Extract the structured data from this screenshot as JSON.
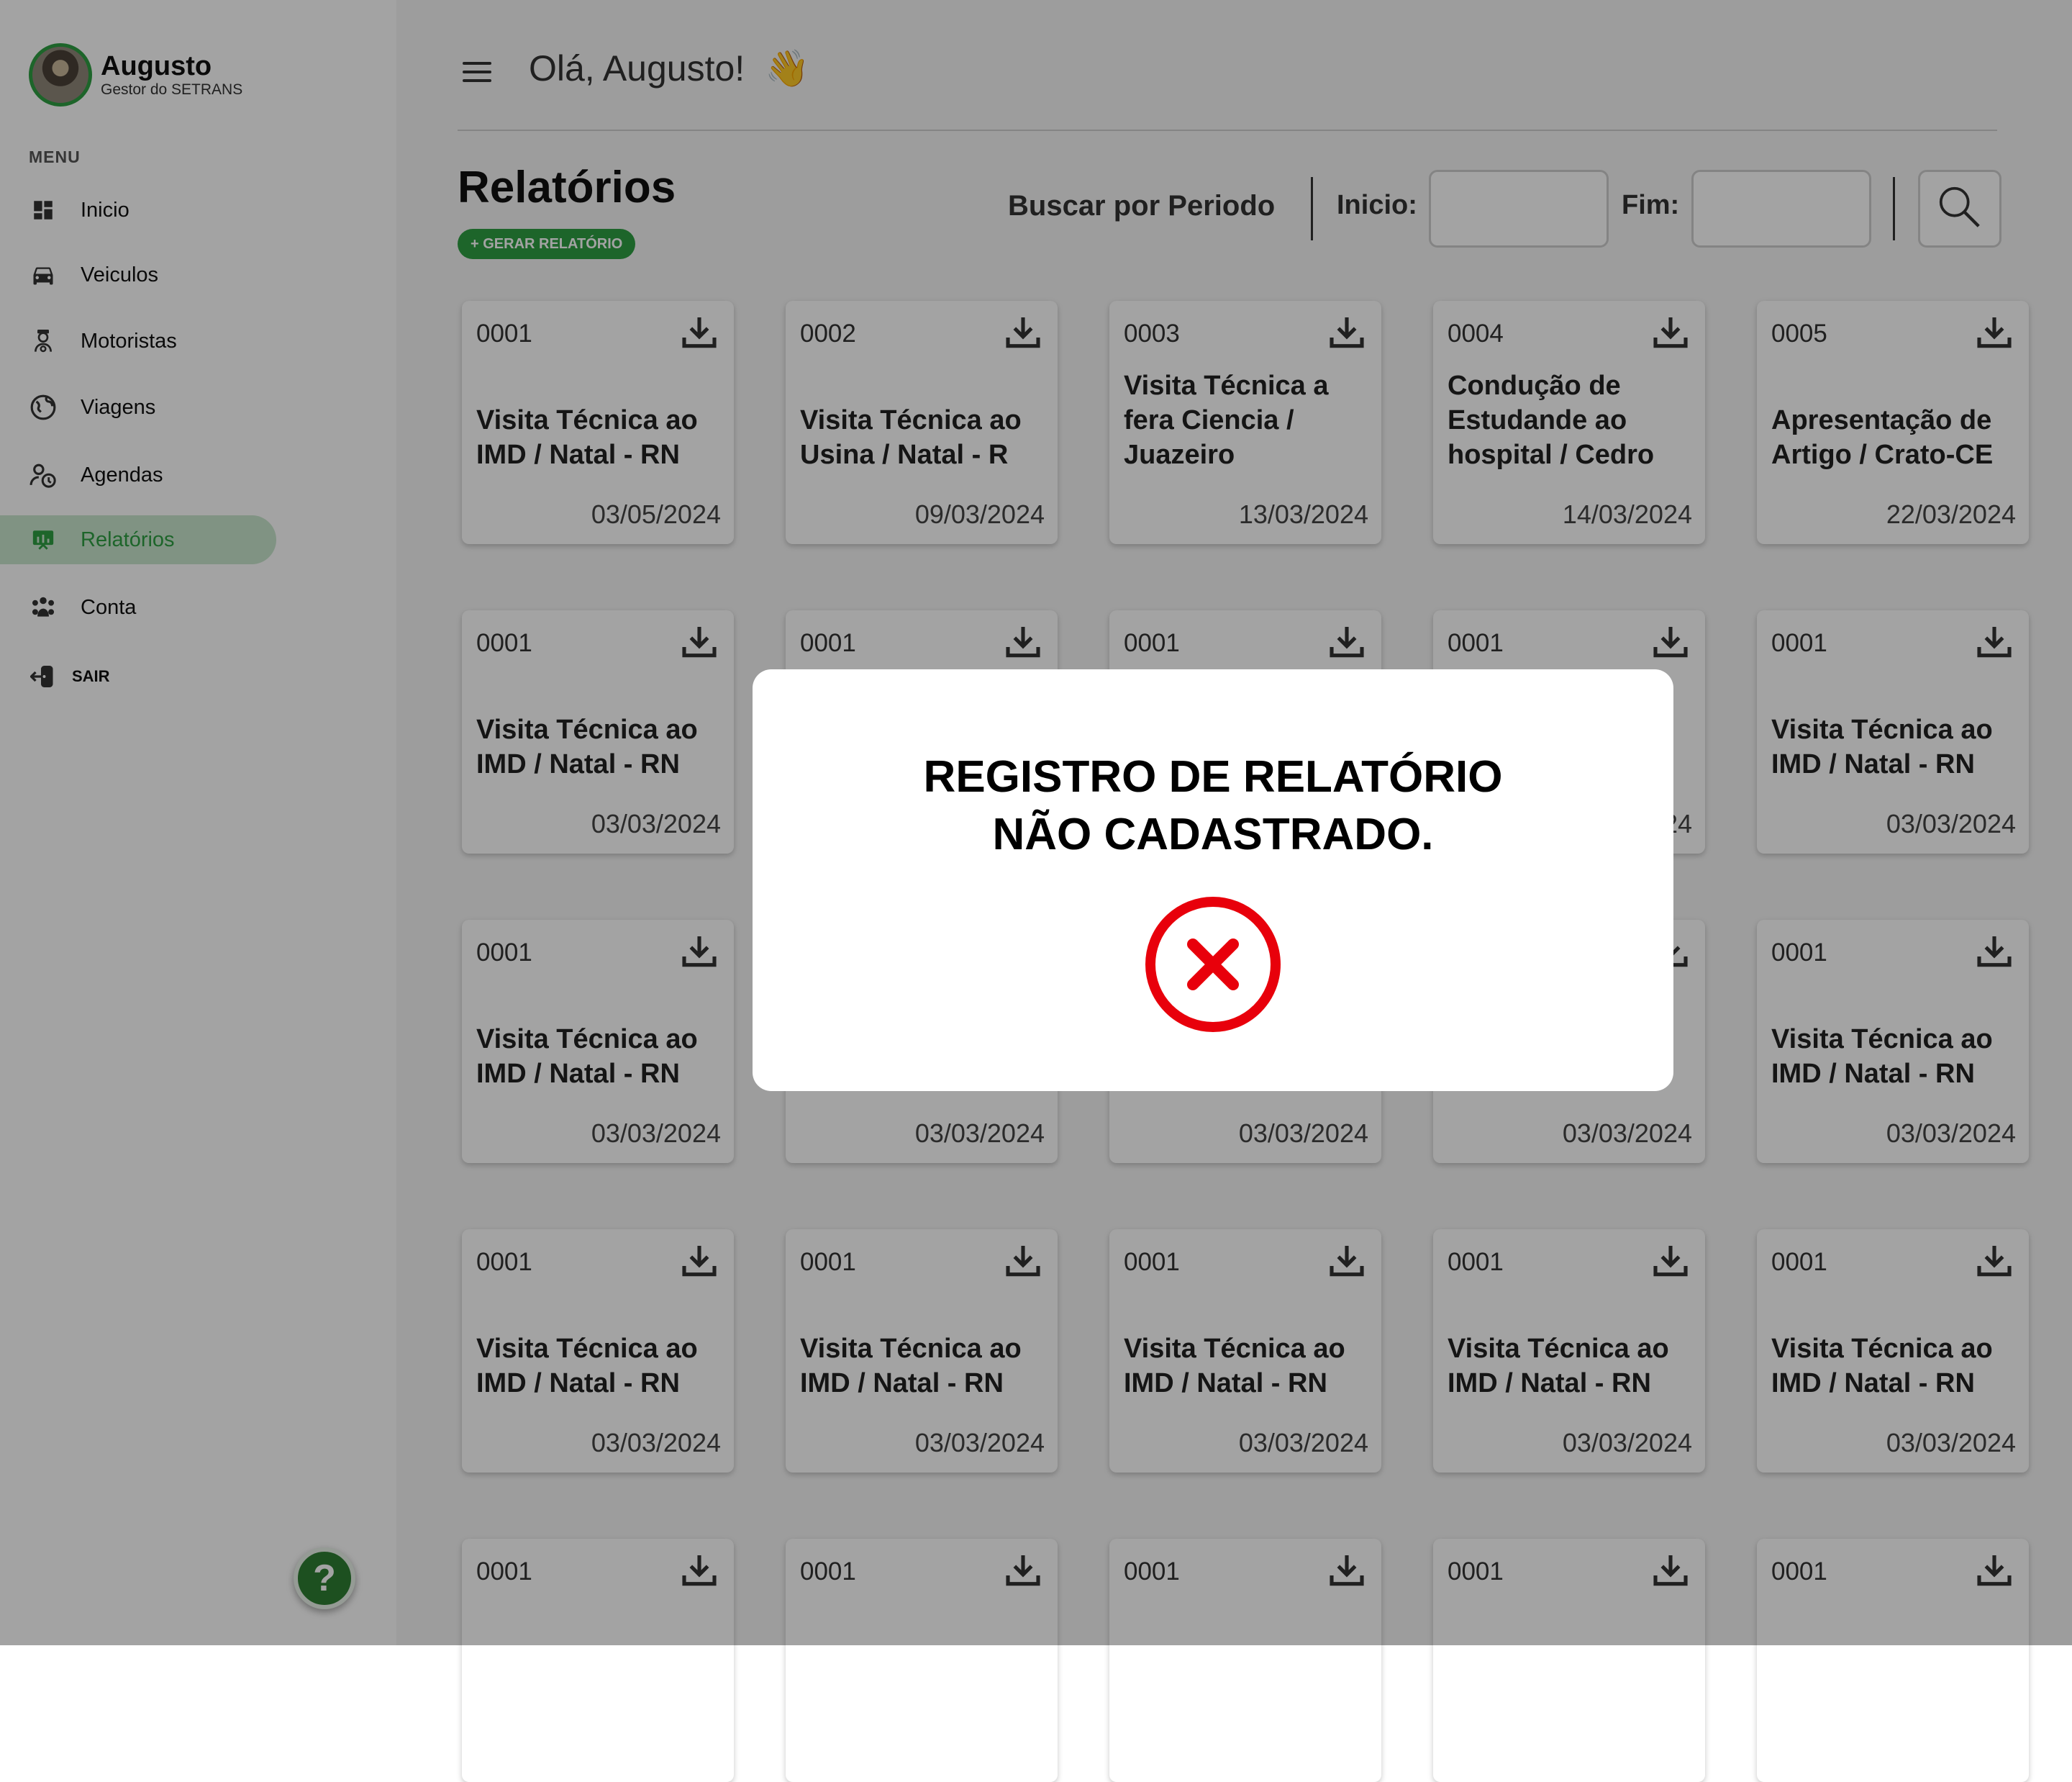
{
  "user": {
    "name": "Augusto",
    "role": "Gestor do SETRANS"
  },
  "menu": {
    "label": "MENU",
    "items": [
      {
        "label": "Inicio",
        "icon": "dashboard-icon"
      },
      {
        "label": "Veiculos",
        "icon": "car-icon"
      },
      {
        "label": "Motoristas",
        "icon": "driver-icon"
      },
      {
        "label": "Viagens",
        "icon": "globe-icon"
      },
      {
        "label": "Agendas",
        "icon": "schedule-icon"
      },
      {
        "label": "Relatórios",
        "icon": "report-icon",
        "active": true
      },
      {
        "label": "Conta",
        "icon": "users-icon"
      }
    ],
    "logout": "SAIR"
  },
  "help": {
    "label": "?"
  },
  "header": {
    "greeting": "Olá, Augusto!",
    "emoji": "👋"
  },
  "page": {
    "title": "Relatórios",
    "generate_button": "+ GERAR RELATÓRIO",
    "search_label": "Buscar por Periodo",
    "start_label": "Inicio:",
    "end_label": "Fim:"
  },
  "cards": [
    {
      "code": "0001",
      "title": "Visita Técnica ao IMD / Natal - RN",
      "date": "03/05/2024"
    },
    {
      "code": "0002",
      "title": "Visita Técnica ao Usina / Natal - R",
      "date": "09/03/2024"
    },
    {
      "code": "0003",
      "title": "Visita Técnica a fera Ciencia / Juazeiro",
      "date": "13/03/2024"
    },
    {
      "code": "0004",
      "title": "Condução de Estudande ao hospital / Cedro",
      "date": "14/03/2024"
    },
    {
      "code": "0005",
      "title": "Apresentação de Artigo / Crato-CE",
      "date": "22/03/2024"
    },
    {
      "code": "0001",
      "title": "Visita Técnica ao IMD / Natal - RN",
      "date": "03/03/2024"
    },
    {
      "code": "0001",
      "title": "",
      "date": ""
    },
    {
      "code": "0001",
      "title": "",
      "date": ""
    },
    {
      "code": "0001",
      "title": "",
      "date": "24"
    },
    {
      "code": "0001",
      "title": "Visita Técnica ao IMD / Natal - RN",
      "date": "03/03/2024"
    },
    {
      "code": "0001",
      "title": "Visita Técnica ao IMD / Natal - RN",
      "date": "03/03/2024"
    },
    {
      "code": "",
      "title": "",
      "date": "03/03/2024"
    },
    {
      "code": "",
      "title": "",
      "date": "03/03/2024"
    },
    {
      "code": "",
      "title": "",
      "date": "03/03/2024"
    },
    {
      "code": "0001",
      "title": "Visita Técnica ao IMD / Natal - RN",
      "date": "03/03/2024"
    },
    {
      "code": "0001",
      "title": "Visita Técnica ao IMD / Natal - RN",
      "date": "03/03/2024"
    },
    {
      "code": "0001",
      "title": "Visita Técnica ao IMD / Natal - RN",
      "date": "03/03/2024"
    },
    {
      "code": "0001",
      "title": "Visita Técnica ao IMD / Natal - RN",
      "date": "03/03/2024"
    },
    {
      "code": "0001",
      "title": "Visita Técnica ao IMD / Natal - RN",
      "date": "03/03/2024"
    },
    {
      "code": "0001",
      "title": "Visita Técnica ao IMD / Natal - RN",
      "date": "03/03/2024"
    },
    {
      "code": "0001",
      "title": "",
      "date": ""
    },
    {
      "code": "0001",
      "title": "",
      "date": ""
    },
    {
      "code": "0001",
      "title": "",
      "date": ""
    },
    {
      "code": "0001",
      "title": "",
      "date": ""
    },
    {
      "code": "0001",
      "title": "",
      "date": ""
    }
  ],
  "modal": {
    "title": "REGISTRO DE RELATÓRIO\nNÃO CADASTRADO.",
    "icon": "error-x-icon"
  },
  "colors": {
    "brand_green": "#2e9e43",
    "error_red": "#e8000b"
  }
}
